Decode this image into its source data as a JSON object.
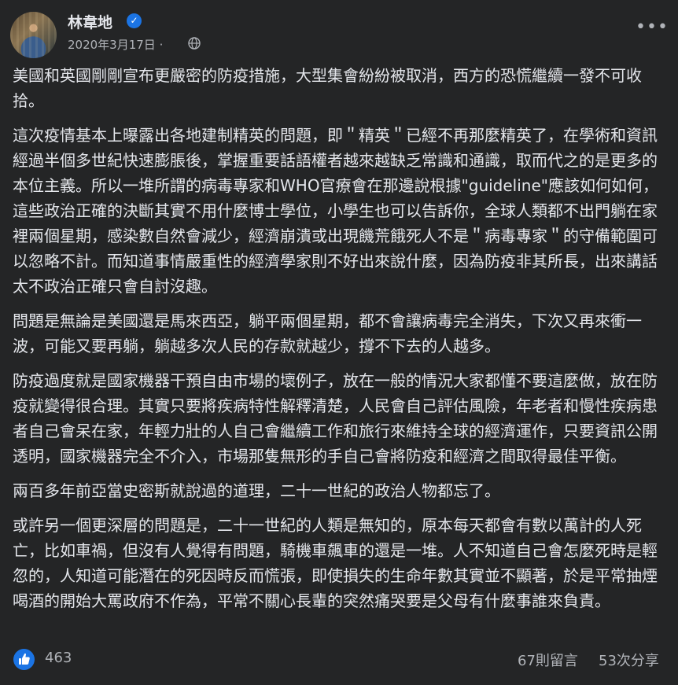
{
  "post": {
    "author": "林韋地",
    "date": "2020年3月17日",
    "date_separator": "·",
    "privacy_icon": "globe-icon",
    "more_icon": "more-options-icon",
    "verified_icon": "verified-badge-icon"
  },
  "paragraphs": [
    "美國和英國剛剛宣布更嚴密的防疫措施，大型集會紛紛被取消，西方的恐慌繼續一發不可收拾。",
    "這次疫情基本上曝露出各地建制精英的問題，即＂精英＂已經不再那麼精英了，在學術和資訊經過半個多世紀快速膨脹後，掌握重要話語權者越來越缺乏常識和通識，取而代之的是更多的本位主義。所以一堆所謂的病毒專家和WHO官療會在那邊說根據\"guideline\"應該如何如何，這些政治正確的決斷其實不用什麼博士學位，小學生也可以告訴你，全球人類都不出門躺在家裡兩個星期，感染數自然會減少，經濟崩潰或出現饑荒餓死人不是＂病毒專家＂的守備範圍可以忽略不計。而知道事情嚴重性的經濟學家則不好出來說什麼，因為防疫非其所長，出來講話太不政治正確只會自討沒趣。",
    "問題是無論是美國還是馬來西亞，躺平兩個星期，都不會讓病毒完全消失，下次又再來衝一波，可能又要再躺，躺越多次人民的存款就越少，撐不下去的人越多。",
    "防疫過度就是國家機器干預自由市場的壞例子，放在一般的情況大家都懂不要這麼做，放在防疫就變得很合理。其實只要將疾病特性解釋清楚，人民會自己評估風險，年老者和慢性疾病患者自己會呆在家，年輕力壯的人自己會繼續工作和旅行來維持全球的經濟運作，只要資訊公開透明，國家機器完全不介入，市場那隻無形的手自己會將防疫和經濟之間取得最佳平衡。",
    "兩百多年前亞當史密斯就說過的道理，二十一世紀的政治人物都忘了。",
    "或許另一個更深層的問題是，二十一世紀的人類是無知的，原本每天都會有數以萬計的人死亡，比如車禍，但沒有人覺得有問題，騎機車飆車的還是一堆。人不知道自己會怎麼死時是輕忽的，人知道可能潛在的死因時反而慌張，即使損失的生命年數其實並不顯著，於是平常抽煙喝酒的開始大罵政府不作為，平常不關心長輩的突然痛哭要是父母有什麼事誰來負責。"
  ],
  "footer": {
    "like_icon": "like-thumbs-up-icon",
    "likes": "463",
    "comments": "67則留言",
    "shares": "53次分享"
  },
  "colors": {
    "background": "#242526",
    "text_primary": "#e4e6eb",
    "text_secondary": "#b0b3b8",
    "accent": "#1b74e4"
  }
}
